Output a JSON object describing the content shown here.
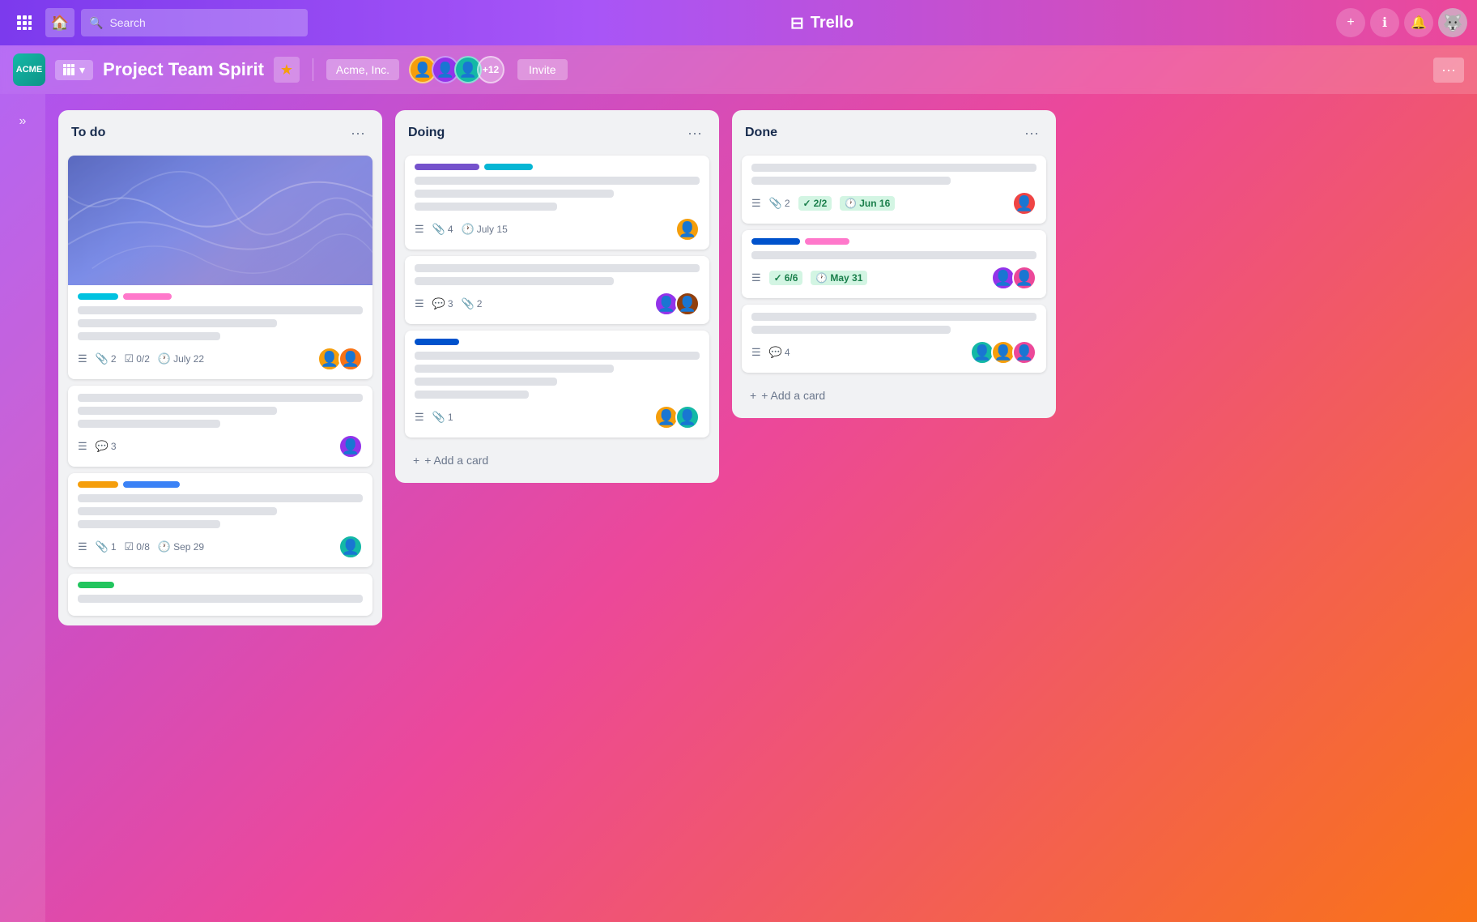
{
  "app": {
    "name": "Trello",
    "logo_symbol": "⊞"
  },
  "topnav": {
    "search_placeholder": "Search",
    "add_label": "+",
    "info_label": "ℹ",
    "bell_label": "🔔"
  },
  "board_header": {
    "workspace_label": "ACME",
    "board_menu_symbol": "⊞",
    "board_title": "Project Team Spirit",
    "star_symbol": "★",
    "workspace_name": "Acme, Inc.",
    "member_count": "+12",
    "invite_label": "Invite",
    "more_symbol": "···",
    "sidebar_toggle": "»"
  },
  "lists": [
    {
      "id": "todo",
      "title": "To do",
      "cards": [
        {
          "id": "card1",
          "has_cover": true,
          "labels": [
            "cyan",
            "pink"
          ],
          "meta_description": true,
          "meta_attachments": "2",
          "meta_checklist": "0/2",
          "meta_date": "July 22",
          "avatars": [
            "yellow",
            "orange"
          ]
        },
        {
          "id": "card2",
          "has_cover": false,
          "labels": [],
          "meta_description": true,
          "meta_comments": "3",
          "avatars": [
            "purple"
          ]
        },
        {
          "id": "card3",
          "has_cover": false,
          "labels": [
            "yellow",
            "blue2"
          ],
          "meta_description": true,
          "meta_attachments": "1",
          "meta_checklist": "0/8",
          "meta_date": "Sep 29",
          "avatars": [
            "teal"
          ]
        },
        {
          "id": "card4",
          "has_cover": false,
          "labels": [
            "green"
          ],
          "meta_description": false,
          "avatars": []
        }
      ]
    },
    {
      "id": "doing",
      "title": "Doing",
      "cards": [
        {
          "id": "card5",
          "has_cover": false,
          "labels": [
            "purple",
            "cyan2"
          ],
          "meta_description": true,
          "meta_attachments": "4",
          "meta_date": "July 15",
          "avatars": [
            "yellow"
          ]
        },
        {
          "id": "card6",
          "has_cover": false,
          "labels": [],
          "meta_description": true,
          "meta_comments": "3",
          "meta_attachments": "2",
          "avatars": [
            "purple",
            "brown"
          ]
        },
        {
          "id": "card7",
          "has_cover": false,
          "labels": [
            "blue"
          ],
          "meta_description": true,
          "meta_attachments": "1",
          "avatars": [
            "yellow",
            "teal"
          ]
        }
      ]
    },
    {
      "id": "done",
      "title": "Done",
      "cards": [
        {
          "id": "card8",
          "has_cover": false,
          "labels": [],
          "meta_description": true,
          "meta_attachments": "2",
          "meta_checklist_done": "2/2",
          "meta_date_done": "Jun 16",
          "avatars": [
            "red"
          ]
        },
        {
          "id": "card9",
          "has_cover": false,
          "labels": [
            "blue",
            "pink"
          ],
          "meta_description": true,
          "meta_checklist_done": "6/6",
          "meta_date_done": "May 31",
          "avatars": [
            "purple",
            "pink"
          ]
        },
        {
          "id": "card10",
          "has_cover": false,
          "labels": [],
          "meta_description": true,
          "meta_comments": "4",
          "avatars": [
            "teal",
            "yellow",
            "pink"
          ]
        }
      ]
    }
  ],
  "add_card_label": "+ Add a card"
}
